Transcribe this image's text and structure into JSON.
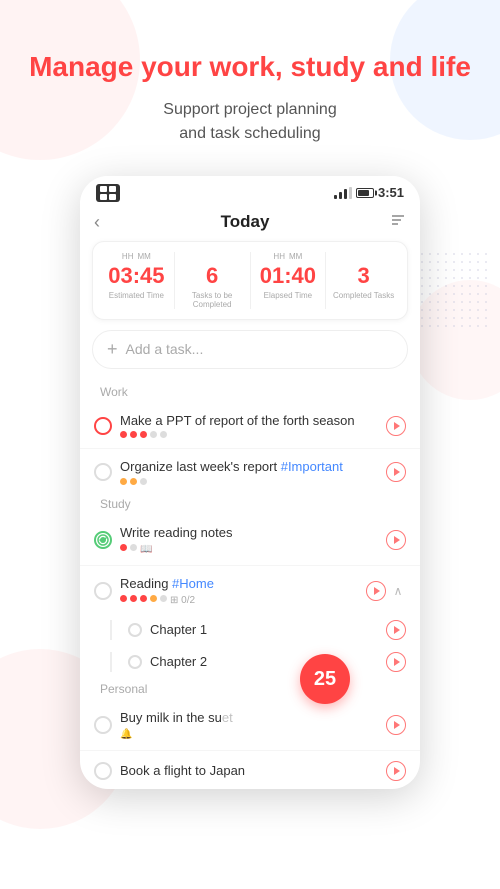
{
  "background": {
    "headline": "Manage your work, study and life",
    "subheadline": "Support project planning\nand task scheduling"
  },
  "phone": {
    "status_bar": {
      "time": "3:51"
    },
    "header": {
      "title": "Today",
      "back": "‹",
      "sort": "↕"
    },
    "stats": [
      {
        "hh_label": "HH",
        "mm_label": "MM",
        "value": "03:45",
        "desc": "Estimated Time"
      },
      {
        "value": "6",
        "desc": "Tasks to be\nCompleted"
      },
      {
        "hh_label": "HH",
        "mm_label": "MM",
        "value": "01:40",
        "desc": "Elapsed Time"
      },
      {
        "value": "3",
        "desc": "Completed Tasks"
      }
    ],
    "add_task_placeholder": "Add a task...",
    "sections": [
      {
        "label": "Work",
        "tasks": [
          {
            "id": "t1",
            "text": "Make a PPT of report of the forth season",
            "circle": "red",
            "dots": [
              "red",
              "red",
              "red",
              "gray",
              "gray"
            ],
            "has_play": true
          },
          {
            "id": "t2",
            "text": "Organize last week's report",
            "tag": "#Important",
            "circle": "plain",
            "dots": [
              "orange",
              "orange",
              "gray"
            ],
            "has_play": true
          }
        ]
      },
      {
        "label": "Study",
        "tasks": [
          {
            "id": "t3",
            "text": "Write reading notes",
            "circle": "reading",
            "dots": [
              "red",
              "gray"
            ],
            "has_book": true,
            "has_play": true
          },
          {
            "id": "t4",
            "text": "Reading",
            "tag": "#Home",
            "circle": "plain",
            "dots": [
              "red",
              "red",
              "red",
              "orange",
              "gray"
            ],
            "progress": "0/2",
            "has_play": true,
            "has_expand": true,
            "subtasks": [
              {
                "id": "s1",
                "text": "Chapter 1",
                "has_play": true
              },
              {
                "id": "s2",
                "text": "Chapter 2",
                "has_play": true
              }
            ]
          }
        ]
      },
      {
        "label": "Personal",
        "tasks": [
          {
            "id": "t5",
            "text": "Buy milk in the su",
            "text_suffix": "et",
            "has_bell": true,
            "circle": "plain",
            "has_play": true
          },
          {
            "id": "t6",
            "text": "Book a flight to Japan",
            "circle": "plain",
            "has_play": true
          }
        ]
      }
    ],
    "floating_badge": "25"
  }
}
